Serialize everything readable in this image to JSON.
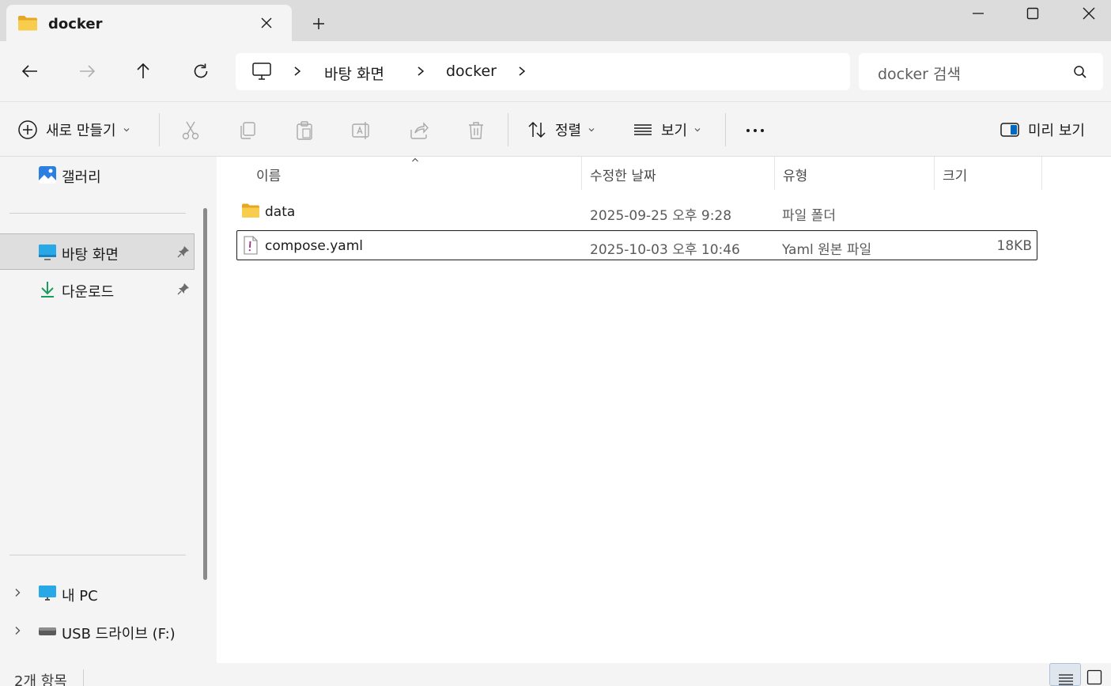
{
  "window": {
    "tab_title": "docker",
    "tab_icon": "folder-icon"
  },
  "address": {
    "crumbs": [
      "바탕 화면",
      "docker"
    ],
    "search_placeholder": "docker 검색"
  },
  "commands": {
    "new": "새로 만들기",
    "sort": "정렬",
    "view": "보기",
    "preview": "미리 보기"
  },
  "sidebar": {
    "gallery": "갤러리",
    "pinned": [
      {
        "label": "바탕 화면",
        "icon": "desktop-icon",
        "selected": true
      },
      {
        "label": "다운로드",
        "icon": "download-icon",
        "selected": false
      }
    ],
    "drives": [
      {
        "label": "내 PC",
        "icon": "pc-icon"
      },
      {
        "label": "USB 드라이브 (F:)",
        "icon": "usb-drive-icon"
      }
    ]
  },
  "columns": {
    "name": "이름",
    "modified": "수정한 날짜",
    "type": "유형",
    "size": "크기"
  },
  "files": [
    {
      "name": "data",
      "modified": "2025-09-25 오후 9:28",
      "type": "파일 폴더",
      "size": "",
      "icon": "folder-icon",
      "selected": false
    },
    {
      "name": "compose.yaml",
      "modified": "2025-10-03 오후 10:46",
      "type": "Yaml 원본 파일",
      "size": "18KB",
      "icon": "yaml-file-icon",
      "selected": true
    }
  ],
  "status": {
    "item_count": "2개 항목"
  },
  "colors": {
    "folder": "#f5c342",
    "chrome": "#f4f4f4",
    "titlebar": "#dcdcdc",
    "accent": "#0067c0"
  }
}
